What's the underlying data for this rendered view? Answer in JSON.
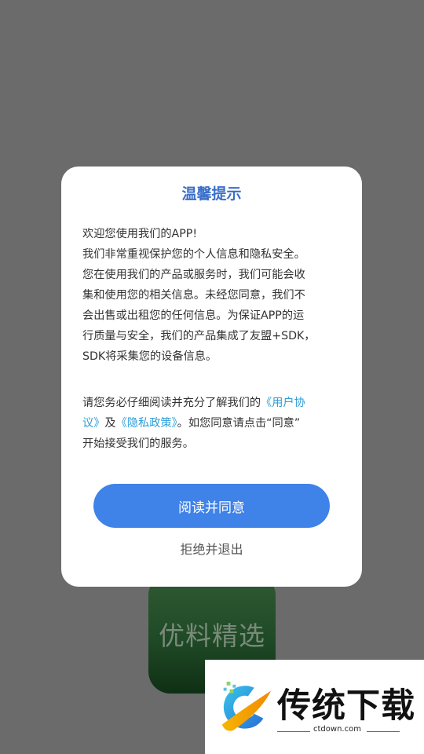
{
  "background_app": {
    "name": "优料精选"
  },
  "dialog": {
    "title": "温馨提示",
    "paragraph1_lines": [
      "欢迎您使用我们的APP!",
      "我们非常重视保护您的个人信息和隐私安全。",
      "您在使用我们的产品或服务时，我们可能会收",
      "集和使用您的相关信息。未经您同意，我们不",
      "会出售或出租您的任何信息。为保证APP的运",
      "行质量与安全，我们的产品集成了友盟+SDK，",
      "SDK将采集您的设备信息。"
    ],
    "paragraph2": {
      "prefix": "请您务必仔细阅读并充分了解我们的",
      "user_agreement_line1": "《用户协",
      "user_agreement_line2": "议》",
      "and": "及",
      "privacy_policy": "《隐私政策》",
      "suffix_line2": "。如您同意请点击“同意”",
      "line3": "开始接受我们的服务。"
    },
    "agree_label": "阅读并同意",
    "reject_label": "拒绝并退出"
  },
  "watermark": {
    "text": "传统下载",
    "url": "ctdown.com"
  },
  "colors": {
    "accent": "#3f82e8",
    "title": "#3b6fc9",
    "link": "#2c9ed8",
    "overlay": "#6b6b6b"
  }
}
